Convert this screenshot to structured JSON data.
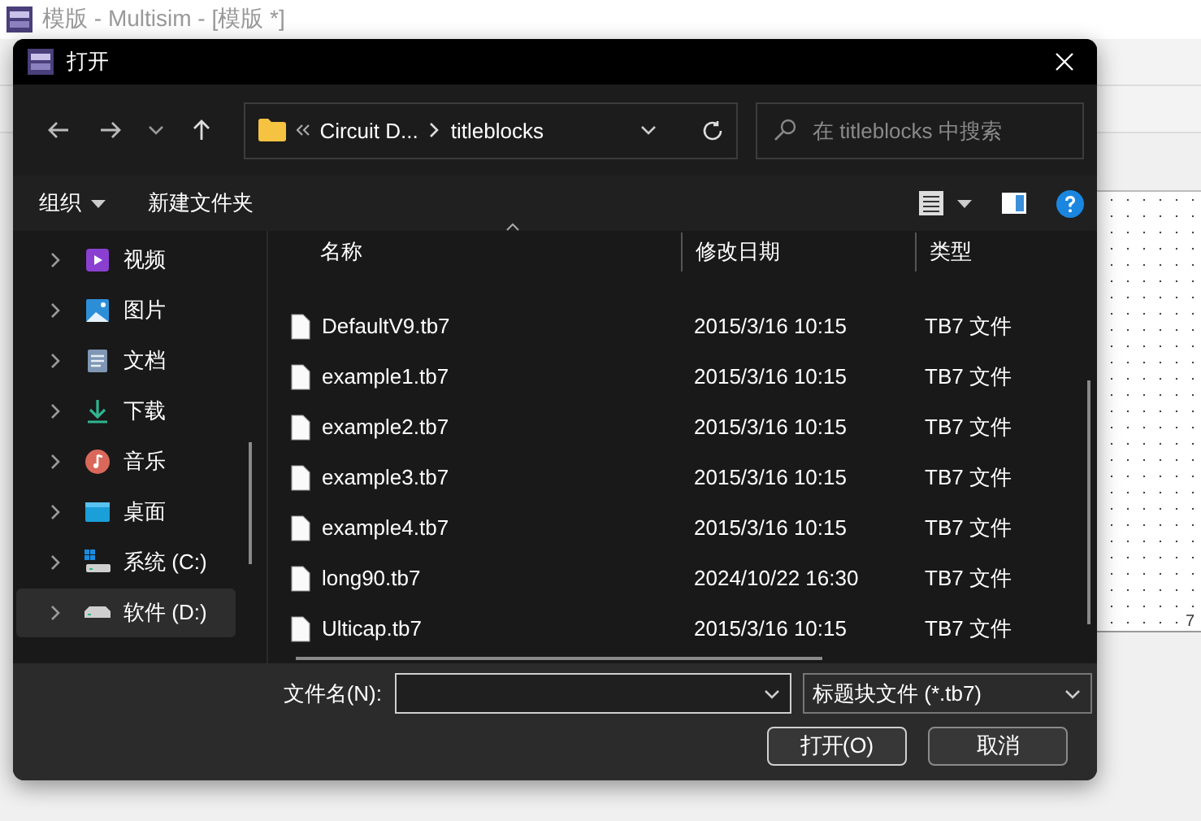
{
  "app": {
    "title": "模版 - Multisim - [模版 *]",
    "canvas_label": "7"
  },
  "dialog": {
    "title": "打开",
    "nav": {
      "path": [
        "Circuit D...",
        "titleblocks"
      ],
      "search": {
        "placeholder": "在 titleblocks 中搜索"
      }
    },
    "commands": [
      {
        "label": "组织",
        "kind": "menu"
      },
      {
        "label": "新建文件夹",
        "kind": "button"
      }
    ],
    "sidebar": {
      "items": [
        {
          "label": "视频",
          "kind": "videos",
          "selected": false
        },
        {
          "label": "图片",
          "kind": "pictures",
          "selected": false
        },
        {
          "label": "文档",
          "kind": "documents",
          "selected": false
        },
        {
          "label": "下载",
          "kind": "downloads",
          "selected": false
        },
        {
          "label": "音乐",
          "kind": "music",
          "selected": false
        },
        {
          "label": "桌面",
          "kind": "desktop",
          "selected": false
        },
        {
          "label": "系统 (C:)",
          "kind": "system-drive",
          "selected": false
        },
        {
          "label": "软件 (D:)",
          "kind": "drive",
          "selected": true
        }
      ]
    },
    "table": {
      "columns": [
        "名称",
        "修改日期",
        "类型"
      ],
      "rows": [
        {
          "name": "DefaultV9.tb7",
          "date": "2015/3/16 10:15",
          "type": "TB7 文件"
        },
        {
          "name": "example1.tb7",
          "date": "2015/3/16 10:15",
          "type": "TB7 文件"
        },
        {
          "name": "example2.tb7",
          "date": "2015/3/16 10:15",
          "type": "TB7 文件"
        },
        {
          "name": "example3.tb7",
          "date": "2015/3/16 10:15",
          "type": "TB7 文件"
        },
        {
          "name": "example4.tb7",
          "date": "2015/3/16 10:15",
          "type": "TB7 文件"
        },
        {
          "name": "long90.tb7",
          "date": "2024/10/22 16:30",
          "type": "TB7 文件"
        },
        {
          "name": "Ulticap.tb7",
          "date": "2015/3/16 10:15",
          "type": "TB7 文件"
        }
      ]
    },
    "footer": {
      "filename_label": "文件名(N):",
      "filetype": "标题块文件 (*.tb7)",
      "buttons": [
        "打开(O)",
        "取消"
      ]
    }
  }
}
